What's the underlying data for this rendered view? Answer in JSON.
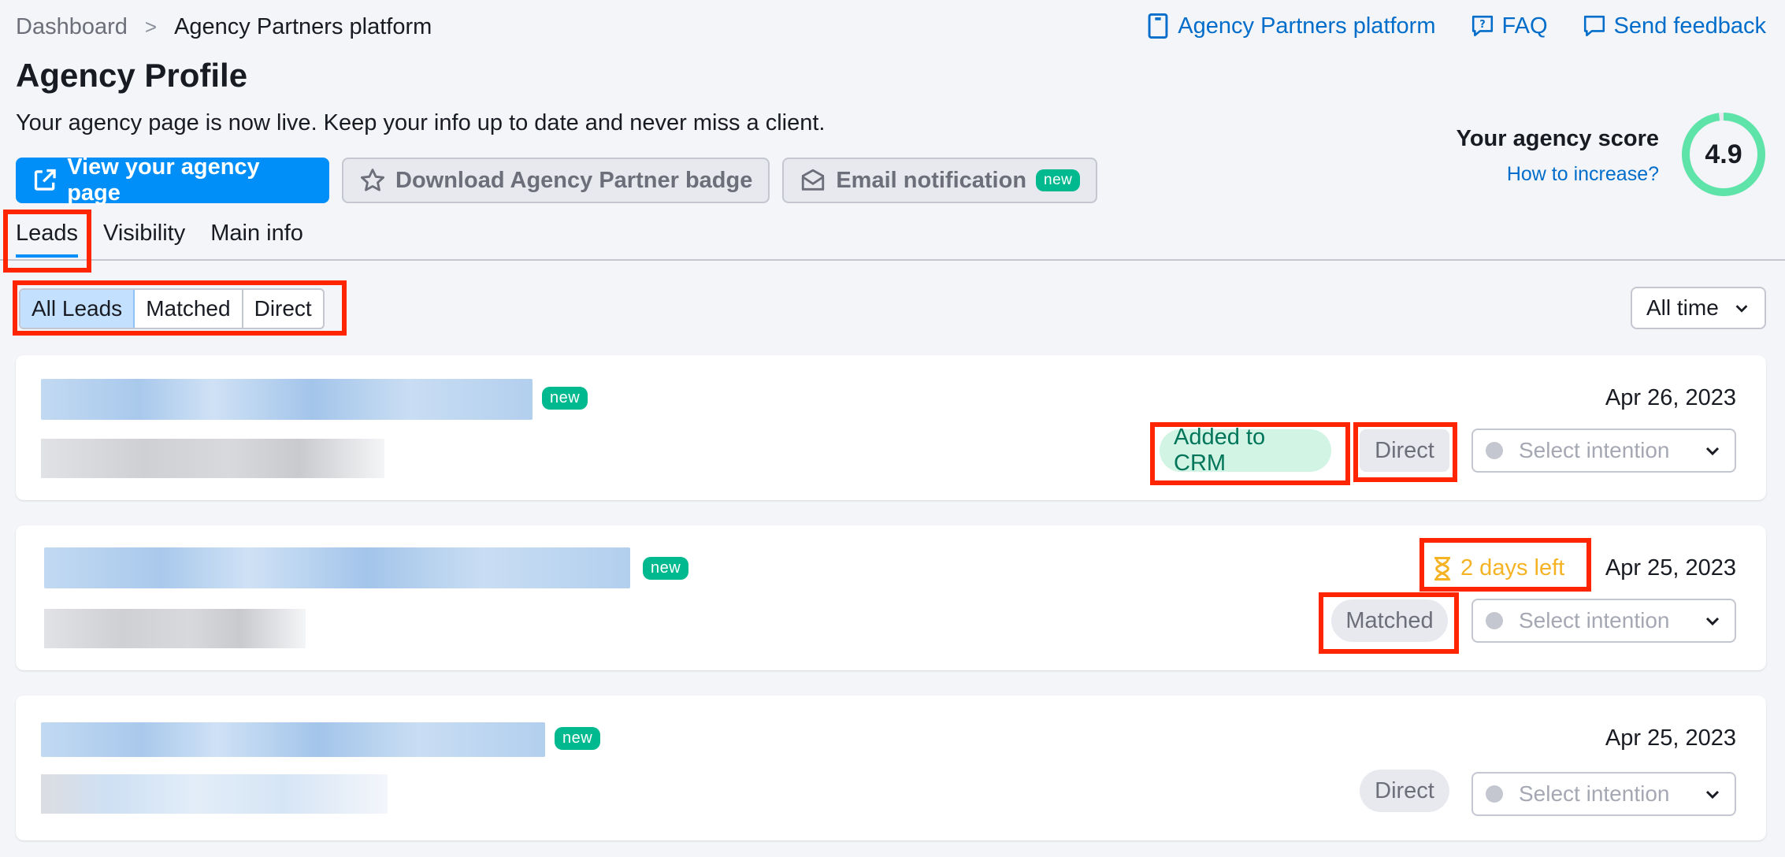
{
  "breadcrumb": {
    "items": [
      "Dashboard",
      "Agency Partners platform"
    ],
    "separator": ">"
  },
  "toplinks": {
    "platform": "Agency Partners platform",
    "faq": "FAQ",
    "feedback": "Send feedback"
  },
  "page": {
    "title": "Agency Profile",
    "subtitle": "Your agency page is now live. Keep your info up to date and never miss a client."
  },
  "actions": {
    "view_page": "View your agency page",
    "download_badge": "Download Agency Partner badge",
    "email_notification": "Email notification",
    "new_badge": "new"
  },
  "score": {
    "title": "Your agency score",
    "link": "How to increase?",
    "value": "4.9",
    "fraction": 0.98
  },
  "tabs": [
    {
      "label": "Leads"
    },
    {
      "label": "Visibility"
    },
    {
      "label": "Main info"
    }
  ],
  "filters": {
    "segments": [
      "All Leads",
      "Matched",
      "Direct"
    ],
    "time": "All time"
  },
  "leads": [
    {
      "new": "new",
      "date": "Apr 26, 2023",
      "status": "Added to CRM",
      "type": "Direct",
      "days_left": "",
      "intention_placeholder": "Select intention"
    },
    {
      "new": "new",
      "date": "Apr 25, 2023",
      "status": "",
      "type": "Matched",
      "days_left": "2 days left",
      "intention_placeholder": "Select intention"
    },
    {
      "new": "new",
      "date": "Apr 25, 2023",
      "status": "",
      "type": "Direct",
      "days_left": "",
      "intention_placeholder": "Select intention"
    }
  ],
  "colors": {
    "primary": "#008ff8",
    "link": "#006dca",
    "new_badge": "#00b98e",
    "score_ring": "#5ee3a8",
    "highlight": "#ff2500",
    "warning": "#f5b324"
  }
}
